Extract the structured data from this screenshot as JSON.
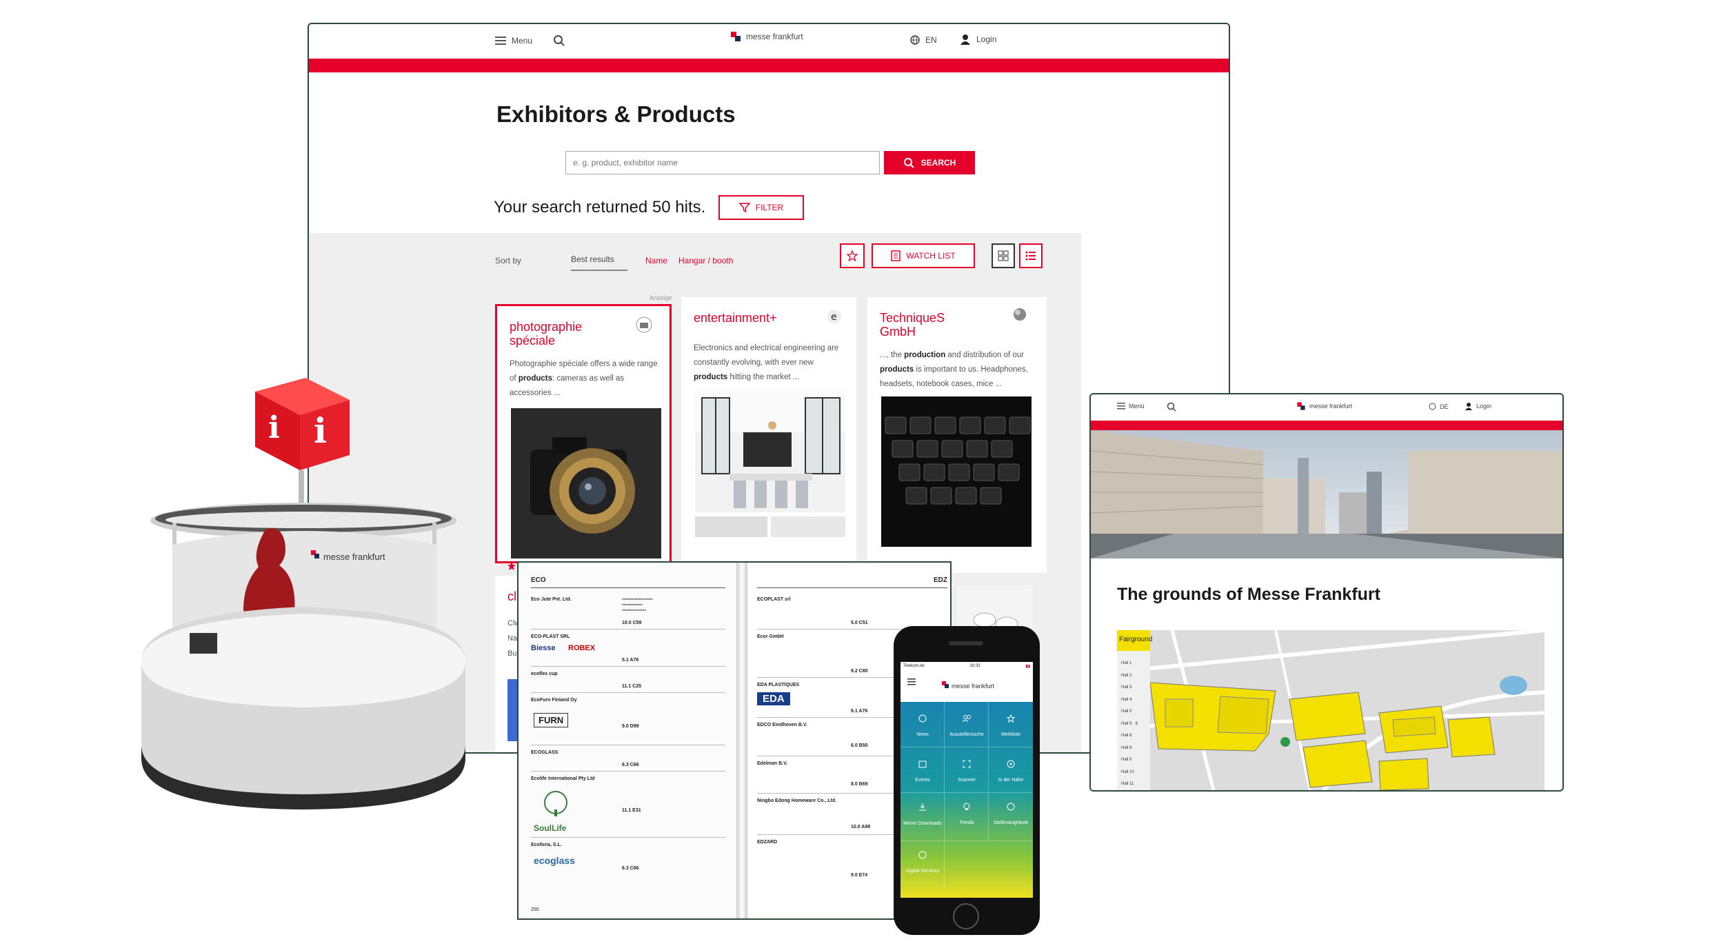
{
  "desktop": {
    "topbar": {
      "menu_label": "Menu",
      "brand": "messe frankfurt",
      "language": "EN",
      "login_label": "Login"
    },
    "title": "Exhibitors & Products",
    "search": {
      "placeholder": "e. g. product, exhibitor name",
      "button_label": "SEARCH"
    },
    "results_text": "Your search returned 50 hits.",
    "filter_label": "FILTER",
    "sort": {
      "label": "Sort by",
      "options": [
        "Best results",
        "Name",
        "Hangar / booth"
      ]
    },
    "watchlist_label": "WATCH LIST",
    "ad_label": "Anzeige",
    "cards": [
      {
        "title": "photographie spéciale",
        "text_before": "Photographie spéciale offers a wide range of ",
        "bold1": "products",
        "text_after": ": cameras as well as accessories ..."
      },
      {
        "title": "entertainment+",
        "text_before": "Electronics and electrical engineering are constantly evolving, with ever new ",
        "bold1": "products",
        "text_after": " hitting the market ..."
      },
      {
        "title": "TechniqueS GmbH",
        "text_before": "..., the ",
        "bold1": "production",
        "text_mid": " and distribution of our ",
        "bold2": "products",
        "text_after": " is important to us. Headphones, headsets, notebook cases, mice ..."
      }
    ],
    "partial_card": {
      "title": "cl",
      "lines": [
        "Clw",
        "Nar",
        "Bud"
      ]
    }
  },
  "counter": {
    "brand": "messe frankfurt",
    "sign_glyph": "i"
  },
  "catalog": {
    "left_header": "ECO",
    "right_header": "EDZ",
    "left_page_number": "250",
    "left_entries": [
      "Eco Jute Pvt. Ltd.",
      "ECO-PLAST SRL",
      "ecoflex cup",
      "EcoFurn Finland Oy",
      "ECOGLASS",
      "Ecolife International Pty Ltd",
      "Ecoforia, S.L."
    ],
    "left_codes": [
      "10.0 C59",
      "5.1 A76",
      "11.1 C25",
      "9.0 D99",
      "6.3 C66",
      "11.1 E31",
      "6.3 C66"
    ],
    "right_entries": [
      "ECOPLAST srl",
      "Ecor GmbH",
      "EDA PLASTIQUES",
      "EDCO Eindhoven B.V.",
      "Edelman B.V.",
      "Ningbo Edong Homeware Co., Ltd.",
      "EDZARD"
    ],
    "right_codes": [
      "5.0 C51",
      "9.2 C80",
      "6.1 A76",
      "6.0 B50",
      "8.0 B69",
      "10.0 A98",
      "9.0 E74"
    ],
    "logos": [
      "Biesse",
      "ROBEX",
      "EDA",
      "FURN",
      "SoulLife",
      "ecoglass"
    ]
  },
  "phone": {
    "carrier": "Telekom.de",
    "time": "10:33",
    "brand": "messe frankfurt",
    "tiles": [
      "News",
      "Ausstellersuche",
      "Merkliste",
      "Events",
      "Scanner",
      "In der Nähe",
      "Meine Downloads",
      "Trends",
      "Stellenangebote",
      "Digital Services"
    ]
  },
  "tablet": {
    "topbar": {
      "menu_label": "Menü",
      "brand": "messe frankfurt",
      "language": "DE",
      "login_label": "Login"
    },
    "heading": "The grounds of Messe Frankfurt",
    "map": {
      "legend_title": "Fairground",
      "halls": [
        "Hall 1",
        "Hall 2",
        "Hall 3",
        "Hall 4",
        "Hall 5",
        "Hall 5 · 6",
        "Hall 6",
        "Hall 8",
        "Hall 9",
        "Hall 10",
        "Hall 11"
      ]
    }
  },
  "colors": {
    "brand_red": "#e4002b",
    "brand_navy": "#1a2a50",
    "frame_green": "#2c4a3a",
    "hall_yellow": "#f3e000",
    "phone_teal": "#1a8f9e"
  }
}
